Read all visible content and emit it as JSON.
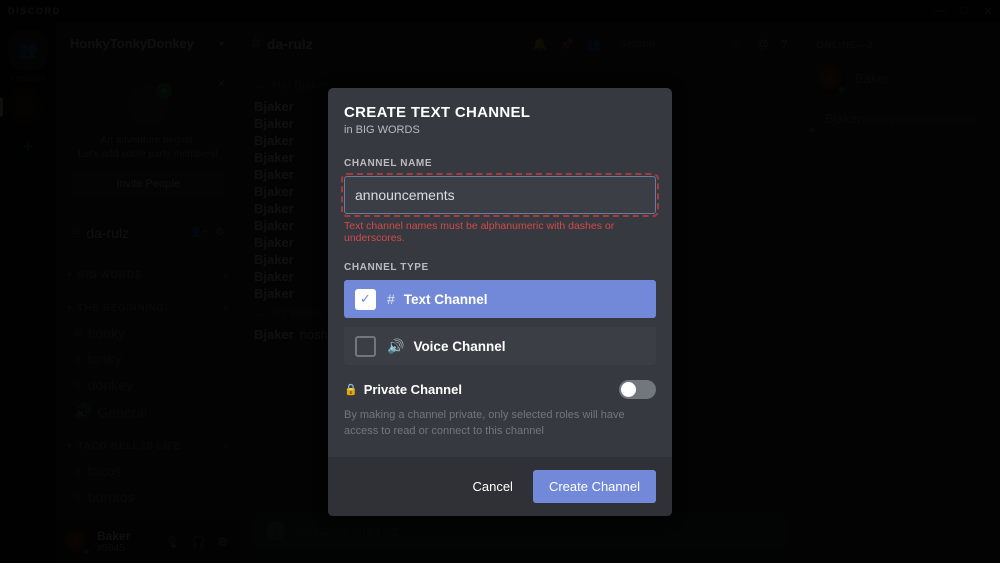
{
  "titlebar": {
    "wordmark": "DISCORD",
    "minimize": "—",
    "maximize": "□",
    "close": "✕"
  },
  "rail": {
    "home_icon": "👥",
    "online_label": "1 ONLINE",
    "add_server": "+"
  },
  "sidebar": {
    "guild_name": "HonkyTonkyDonkey",
    "chevron": "▼",
    "invite_card": {
      "close": "✕",
      "plus": "+",
      "line1": "An adventure begins.",
      "line2": "Let's add some party members!",
      "button": "Invite People"
    },
    "active_channel": {
      "hash": "#",
      "name": "da-rulz",
      "action_invite": "👤+",
      "action_settings": "⚙"
    },
    "categories": [
      {
        "name": "BIG WORDS",
        "arrow": "▼",
        "add": "+",
        "channels": []
      },
      {
        "name": "THE BEGINNING!",
        "arrow": "▼",
        "add": "+",
        "channels": [
          {
            "glyph": "#",
            "name": "honky"
          },
          {
            "glyph": "#",
            "name": "tonky"
          },
          {
            "glyph": "#",
            "name": "donkey"
          },
          {
            "glyph": "🔊",
            "name": "General"
          }
        ]
      },
      {
        "name": "TACO BELL IS LIFE",
        "arrow": "▼",
        "add": "+",
        "channels": [
          {
            "glyph": "#",
            "name": "tacos"
          },
          {
            "glyph": "#",
            "name": "burritos"
          }
        ]
      }
    ],
    "user": {
      "name": "Baker",
      "tag": "#5645",
      "mic_icon": "🎙",
      "headset_icon": "🎧",
      "settings_icon": "⚙"
    }
  },
  "topbar": {
    "hash": "#",
    "channel": "da-rulz",
    "bell_icon": "🔔",
    "pin_icon": "📌",
    "members_icon": "👥",
    "search_placeholder": "Search",
    "search_icon": "⌕",
    "mentions_icon": "@",
    "help_icon": "?"
  },
  "chat": {
    "system_lines": [
      {
        "arrow": "→",
        "text": "Ha! Bjaker"
      },
      {
        "arrow": "→",
        "text": "It's Bjaker"
      }
    ],
    "messages": [
      {
        "who": "Bjaker",
        "text": ""
      },
      {
        "who": "Bjaker",
        "text": ""
      },
      {
        "who": "Bjaker",
        "text": ""
      },
      {
        "who": "Bjaker",
        "text": ""
      },
      {
        "who": "Bjaker",
        "text": ""
      },
      {
        "who": "Bjaker",
        "text": ""
      },
      {
        "who": "Bjaker",
        "text": ""
      },
      {
        "who": "Bjaker",
        "text": ""
      },
      {
        "who": "Bjaker",
        "text": ""
      },
      {
        "who": "Bjaker",
        "text": ""
      },
      {
        "who": "Bjaker",
        "text": ""
      },
      {
        "who": "Bjaker",
        "text": ""
      }
    ],
    "last_message": {
      "who": "Bjaker",
      "text": "noshiki | :D"
    },
    "composer": {
      "plus_icon": "+",
      "placeholder": "Message #da-rulz",
      "emoji_icon": "☺"
    }
  },
  "members": {
    "header": "ONLINE—2",
    "list": [
      {
        "name": "Baker",
        "status": ""
      },
      {
        "name": "Bjaker",
        "status": "Playing https://dis.gd/cont..."
      }
    ]
  },
  "modal": {
    "title": "CREATE TEXT CHANNEL",
    "subtitle": "in BIG WORDS",
    "name_label": "CHANNEL NAME",
    "name_value": "announcements",
    "error": "Text channel names must be alphanumeric with dashes or underscores.",
    "type_label": "CHANNEL TYPE",
    "types": [
      {
        "glyph": "#",
        "label": "Text Channel",
        "check": "✓",
        "selected": true
      },
      {
        "glyph": "🔊",
        "label": "Voice Channel",
        "check": "",
        "selected": false
      }
    ],
    "private": {
      "lock_icon": "🔒",
      "label": "Private Channel",
      "enabled": false,
      "description": "By making a channel private, only selected roles will have access to read or connect to this channel"
    },
    "cancel": "Cancel",
    "create": "Create Channel"
  },
  "colors": {
    "blurple": "#7289da",
    "error_red": "#d04b4b",
    "online_green": "#3ba55d"
  }
}
